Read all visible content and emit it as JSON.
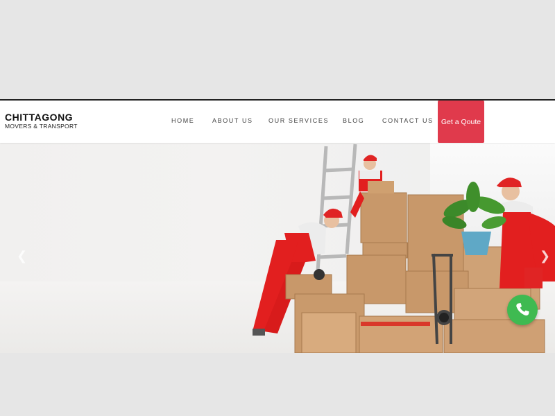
{
  "brand": {
    "title": "CHITTAGONG",
    "subtitle": "MOVERS & TRANSPORT"
  },
  "nav": {
    "items": [
      {
        "label": "HOME"
      },
      {
        "label": "ABOUT US"
      },
      {
        "label": "OUR SERVICES"
      },
      {
        "label": "BLOG"
      },
      {
        "label": "CONTACT US"
      }
    ],
    "cta_label": "Get a Qoute"
  },
  "hero": {
    "prev_icon": "chevron-left-icon",
    "next_icon": "chevron-right-icon",
    "image_description_icon": "movers-photo"
  },
  "whatsapp": {
    "icon": "phone-icon"
  },
  "colors": {
    "accent": "#e03a4c",
    "whatsapp": "#3fba51",
    "page_bg": "#e6e6e6"
  }
}
